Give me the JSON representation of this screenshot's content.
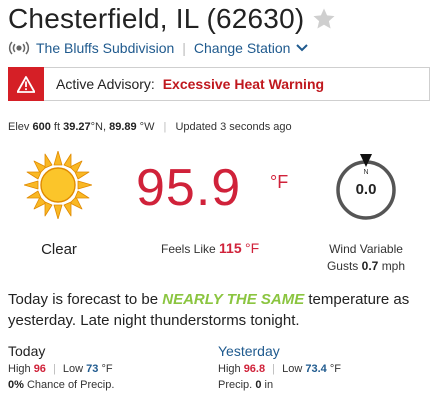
{
  "header": {
    "title": "Chesterfield, IL (62630)",
    "station_name": "The Bluffs Subdivision",
    "change_station": "Change Station"
  },
  "icons": {
    "favorite": "star-icon",
    "station": "broadcast-icon",
    "change_station": "chevron-down-icon",
    "advisory": "warning-icon",
    "condition": "sun-icon",
    "wind": "wind-compass-icon"
  },
  "advisory": {
    "label": "Active Advisory:",
    "link": "Excessive Heat Warning"
  },
  "meta": {
    "elev_label": "Elev",
    "elev_value": "600",
    "elev_unit": "ft",
    "lat_value": "39.27",
    "lat_unit": "°N,",
    "lon_value": "89.89",
    "lon_unit": "°W",
    "updated": "Updated 3 seconds ago"
  },
  "current": {
    "temperature": "95.9",
    "temp_unit": "°F",
    "condition": "Clear",
    "feels_label": "Feels Like",
    "feels_value": "115",
    "feels_unit": "°F"
  },
  "wind": {
    "dial_letter": "N",
    "value": "0.0",
    "direction": "Wind Variable",
    "gusts_label": "Gusts",
    "gusts_value": "0.7",
    "gusts_unit": "mph"
  },
  "forecast": {
    "text_before": "Today is forecast to be ",
    "highlight": "NEARLY THE SAME",
    "text_after": " temperature as yesterday. Late night thunderstorms tonight."
  },
  "today": {
    "title": "Today",
    "high_label": "High",
    "high": "96",
    "low_label": "Low",
    "low": "73",
    "unit": "°F",
    "precip_value": "0%",
    "precip_label": "Chance of Precip."
  },
  "yesterday": {
    "title": "Yesterday",
    "high_label": "High",
    "high": "96.8",
    "low_label": "Low",
    "low": "73.4",
    "unit": "°F",
    "precip_label": "Precip.",
    "precip_value": "0",
    "precip_unit": "in"
  },
  "colors": {
    "temperature": "#d0223a",
    "link": "#1f5a8e",
    "advisory": "#d51f26",
    "highlight": "#8bc540"
  }
}
